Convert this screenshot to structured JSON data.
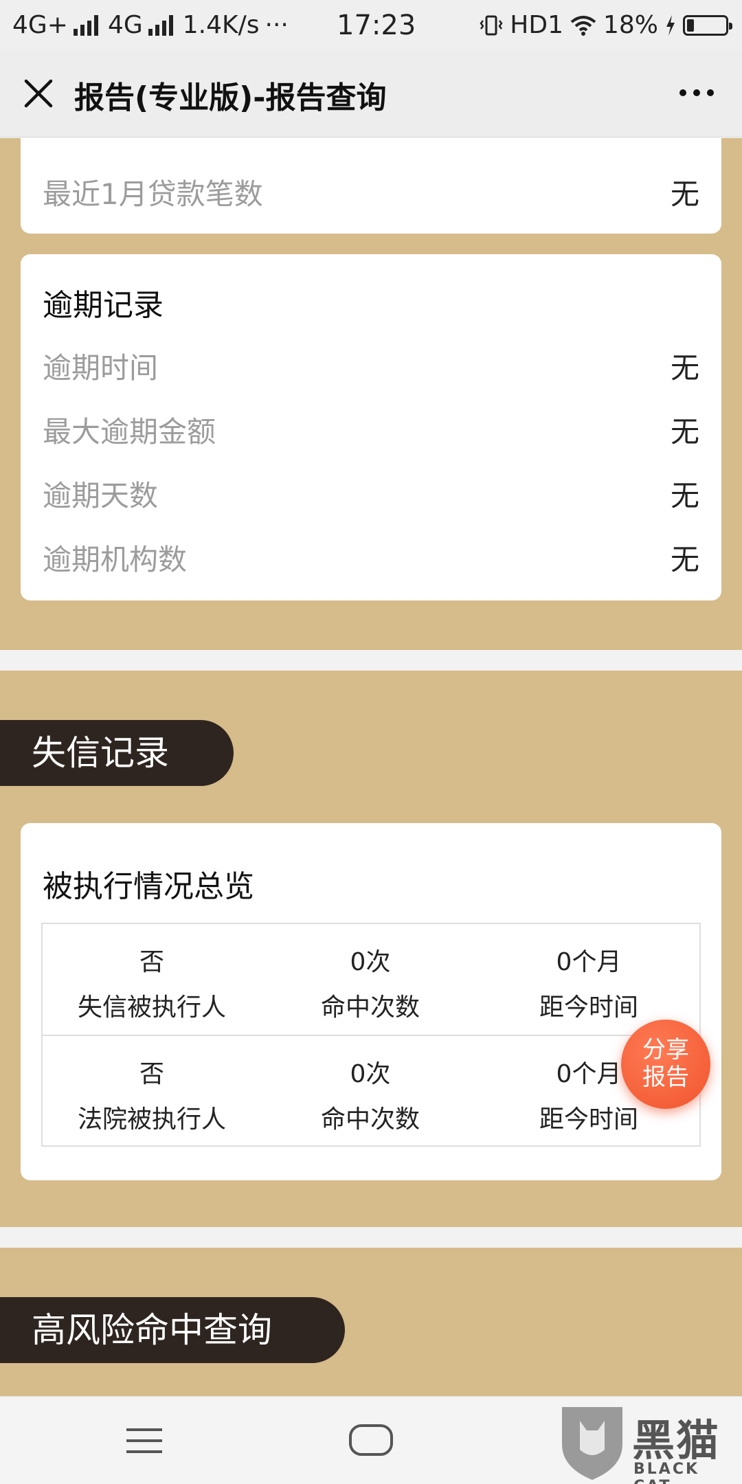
{
  "status_bar": {
    "left": "4G+",
    "left2": "4G",
    "speed": "1.4K/s",
    "more": "···",
    "time": "17:23",
    "network": "HD1",
    "battery": "18%",
    "battery_level": 0.18
  },
  "title_bar": {
    "title": "报告(专业版)-报告查询"
  },
  "loan_card": {
    "rows": [
      {
        "label": "最近1月贷款笔数",
        "value": "无"
      }
    ]
  },
  "overdue_card": {
    "title": "逾期记录",
    "rows": [
      {
        "label": "逾期时间",
        "value": "无"
      },
      {
        "label": "最大逾期金额",
        "value": "无"
      },
      {
        "label": "逾期天数",
        "value": "无"
      },
      {
        "label": "逾期机构数",
        "value": "无"
      }
    ]
  },
  "dishonest_section": {
    "pill": "失信记录",
    "card_title": "被执行情况总览",
    "table": [
      [
        {
          "top": "否",
          "bottom": "失信被执行人"
        },
        {
          "top": "0次",
          "bottom": "命中次数"
        },
        {
          "top": "0个月",
          "bottom": "距今时间"
        }
      ],
      [
        {
          "top": "否",
          "bottom": "法院被执行人"
        },
        {
          "top": "0次",
          "bottom": "命中次数"
        },
        {
          "top": "0个月",
          "bottom": "距今时间"
        }
      ]
    ]
  },
  "high_risk_section": {
    "pill": "高风险命中查询"
  },
  "share_button": {
    "line1": "分享",
    "line2": "报告"
  },
  "watermark": {
    "text": "黑猫",
    "sub": "BLACK CAT"
  }
}
